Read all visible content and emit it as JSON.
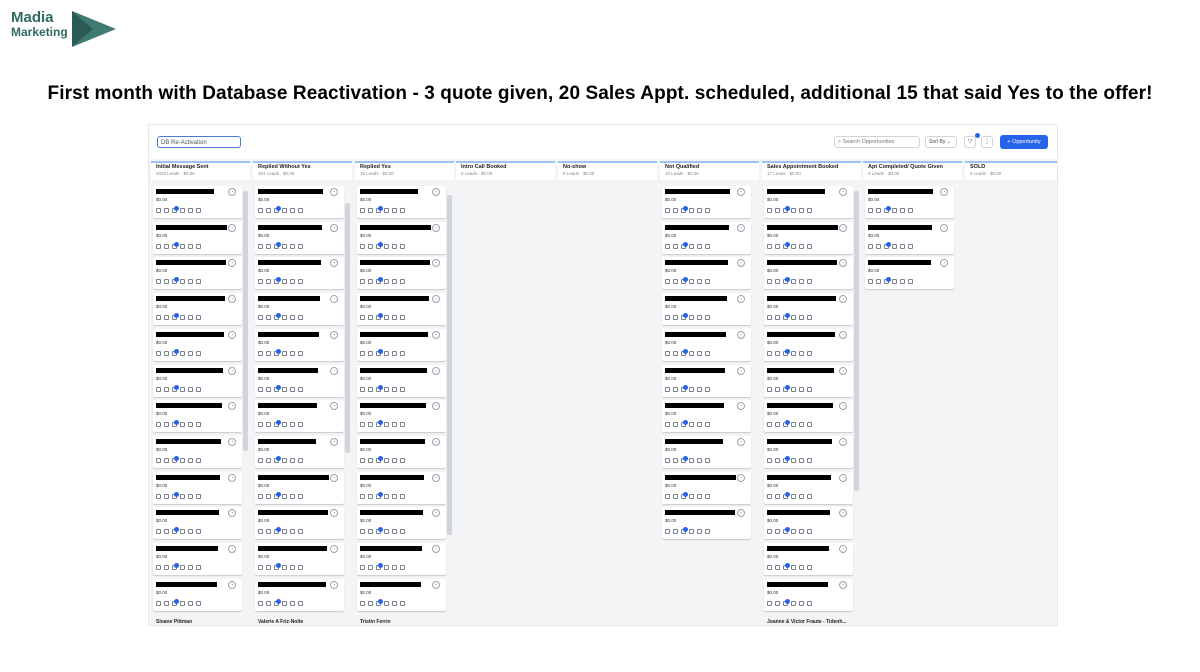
{
  "brand": {
    "line1": "Madia",
    "line2": "Marketing",
    "accent": "#2e6a62"
  },
  "headline": "First month with Database Reactivation - 3 quote given, 20 Sales Appt. scheduled, additional 15 that said Yes to the offer!",
  "toolbar": {
    "pipeline": "DB Re-Activation",
    "search_placeholder": "Search Opportunities",
    "sort": "Sort By",
    "add_button": "+ Opportunity",
    "accent": "#2563eb"
  },
  "stages": [
    {
      "name": "Initial Message Sent",
      "meta": "2026 Leads · $0.00"
    },
    {
      "name": "Replied Without Yes",
      "meta": "481 Leads · $0.00"
    },
    {
      "name": "Replied Yes",
      "meta": "15 Leads · $0.00"
    },
    {
      "name": "Intro Call Booked",
      "meta": "0 Leads · $0.00"
    },
    {
      "name": "No-show",
      "meta": "0 Leads · $0.00"
    },
    {
      "name": "Not Qualified",
      "meta": "10 Leads · $0.00"
    },
    {
      "name": "Sales Appointment Booked",
      "meta": "17 Leads · $0.00"
    },
    {
      "name": "Apt Completed/ Quote Given",
      "meta": "3 Leads · $0.00"
    },
    {
      "name": "SOLD",
      "meta": "0 Leads · $0.00"
    }
  ],
  "card": {
    "amount": "$0.00"
  },
  "partial_names": {
    "c0": "Sloane Pittman",
    "c1": "Valerie A Friz-Nolte",
    "c2": "Tristin Ferrin",
    "c6": "Joanne & Victor Fraute - Tidenh..."
  }
}
